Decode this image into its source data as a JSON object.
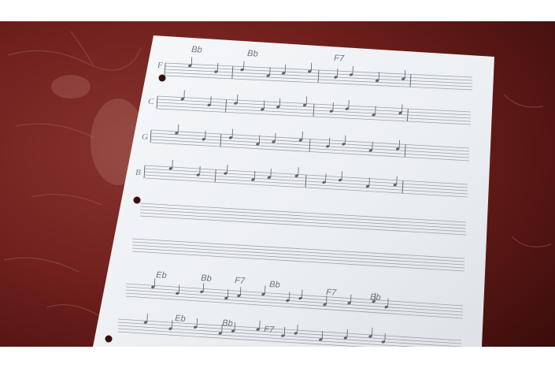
{
  "photo": {
    "subject": "handwritten sheet music page on a dark red leather surface",
    "colors": {
      "leather": "#6e1f1c",
      "leather_dark": "#3c0d0b",
      "leather_highlight": "#9a4a44",
      "paper": "#f1f3f5",
      "staff_line": "#9ba3ab",
      "ink": "#5c646c",
      "letterbox": "#ffffff"
    },
    "chord_symbols": {
      "top_row": [
        "Bb",
        "Bb",
        "F7"
      ],
      "lower_row_1": [
        "Eb",
        "Bb",
        "F7",
        "Bb",
        "F7",
        "Bb"
      ],
      "lower_row_2": [
        "Eb",
        "Bb",
        "F7"
      ]
    },
    "staff_labels": [
      "F",
      "C",
      "G",
      "B"
    ]
  }
}
